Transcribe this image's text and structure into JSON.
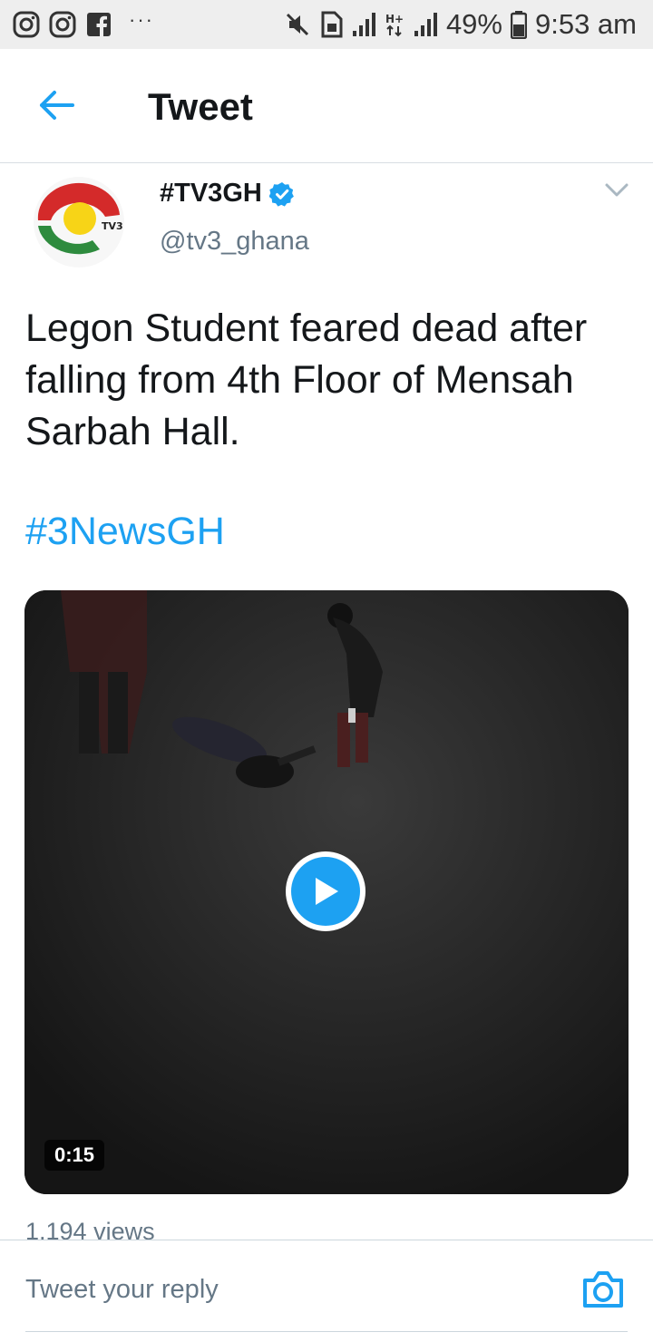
{
  "status_bar": {
    "left_icons": [
      "instagram-icon",
      "instagram-icon",
      "facebook-icon"
    ],
    "overflow": "···",
    "battery": "49%",
    "time": "9:53 am"
  },
  "header": {
    "title": "Tweet",
    "back_icon": "back-arrow-icon"
  },
  "tweet": {
    "display_name": "#TV3GH",
    "verified": true,
    "handle": "@tv3_ghana",
    "avatar_label": "TV3",
    "text": "Legon Student feared dead after falling from 4th Floor of Mensah Sarbah Hall.",
    "hashtag": "#3NewsGH",
    "video": {
      "duration": "0:15"
    },
    "views": "1,194 views"
  },
  "reply_bar": {
    "placeholder": "Tweet your reply",
    "camera_icon": "camera-icon"
  },
  "colors": {
    "accent": "#1da1f2",
    "secondary_text": "#657786",
    "primary_text": "#14171a"
  }
}
